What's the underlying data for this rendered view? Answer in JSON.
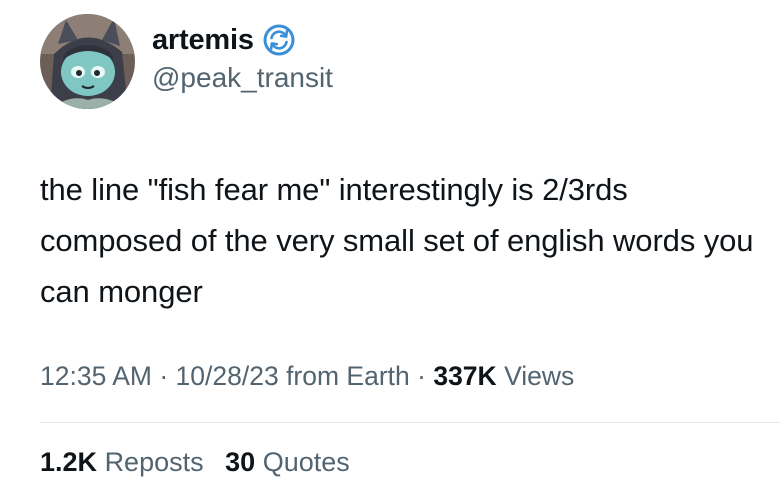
{
  "author": {
    "display_name": "artemis",
    "handle": "@peak_transit",
    "avatar_icon": "cartoon-fox-avatar",
    "badge_icon": "refresh-circle-icon",
    "badge_color": "#3b8fd6"
  },
  "tweet": {
    "text": "the line \"fish fear me\" interestingly is 2/3rds composed of the very small set of english words you can monger"
  },
  "meta": {
    "time": "12:35 AM",
    "date": "10/28/23",
    "source": "from Earth",
    "views_count": "337K",
    "views_label": "Views"
  },
  "stats": {
    "reposts_count": "1.2K",
    "reposts_label": "Reposts",
    "quotes_count": "30",
    "quotes_label": "Quotes"
  },
  "colors": {
    "text_primary": "#0f1419",
    "text_secondary": "#536471",
    "divider": "#e4e8eb"
  }
}
